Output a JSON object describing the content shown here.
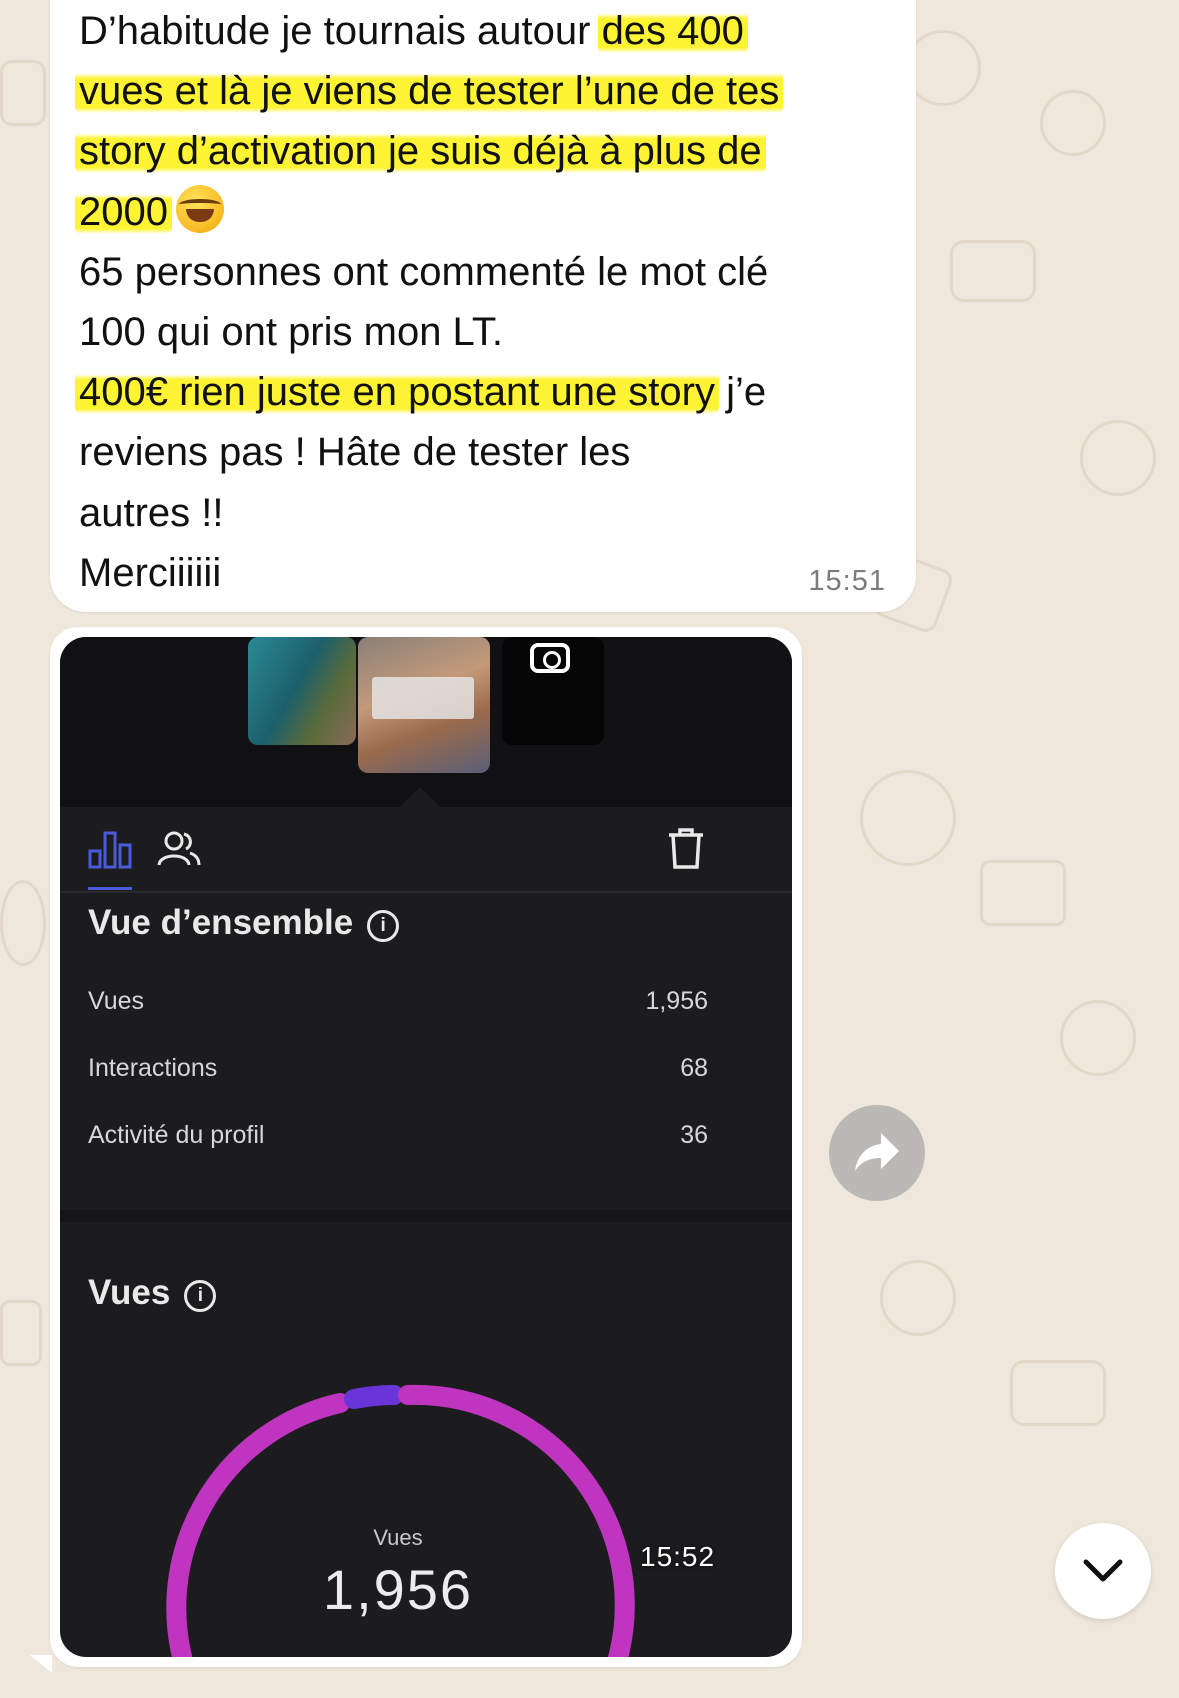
{
  "chat": {
    "message": {
      "lines": [
        [
          "D’habitude je tournais autour ",
          "des 400",
          ""
        ],
        [
          "",
          "vues et là je viens de tester l’une de tes",
          ""
        ],
        [
          "",
          "story d’activation je suis déjà à plus de",
          ""
        ],
        [
          "",
          "2000",
          ""
        ],
        [
          "65 personnes ont commenté le mot clé",
          "",
          ""
        ],
        [
          "100 qui ont pris mon LT.",
          "",
          ""
        ],
        [
          "",
          "400€ rien juste en postant une story",
          " j’e"
        ],
        [
          "reviens pas ! Hâte de tester les",
          "",
          ""
        ],
        [
          "autres !!",
          "",
          ""
        ],
        [
          "Merciiiiii",
          "",
          ""
        ]
      ],
      "emoji": "rolling-on-floor-laughing-emoji",
      "time": "15:51"
    },
    "image_message": {
      "time": "15:52",
      "screenshot": {
        "tabs": [
          "insights-icon",
          "people-icon"
        ],
        "delete_icon": "trash-icon",
        "overview": {
          "title": "Vue d’ensemble",
          "rows": [
            {
              "label": "Vues",
              "value": "1,956"
            },
            {
              "label": "Interactions",
              "value": "68"
            },
            {
              "label": "Activité du profil",
              "value": "36"
            }
          ]
        },
        "views_section": {
          "title": "Vues",
          "ring_label": "Vues",
          "ring_value": "1,956",
          "ring_colors": {
            "main": "#c035c0",
            "secondary": "#6a35d8"
          }
        }
      }
    },
    "controls": {
      "share_icon": "forward-arrow-icon",
      "scroll_icon": "chevron-down-icon"
    },
    "colors": {
      "wallpaper": "#efe7dc",
      "bubble": "#ffffff",
      "highlight": "#fff328",
      "screenshot_bg": "#1c1c1f"
    }
  }
}
